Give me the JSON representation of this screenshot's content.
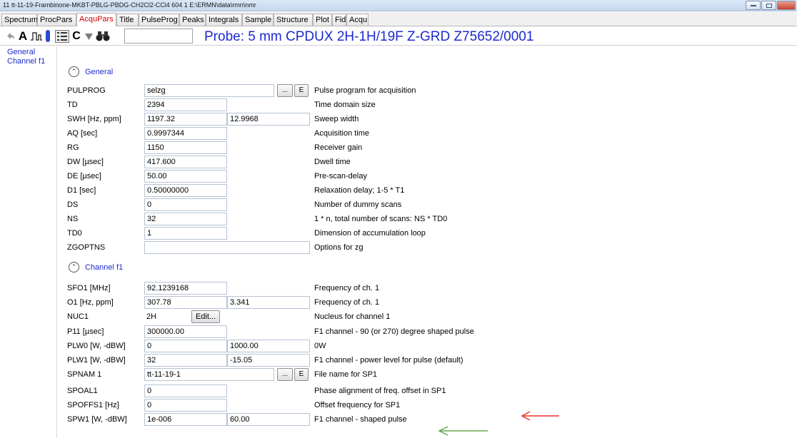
{
  "window": {
    "title": "11 tt-11-19-Frambinone-MKBT-PBLG-PBDG-CH2Cl2-CCl4 604 1 E:\\ERMN\\data\\rmn\\nmr"
  },
  "tabs": [
    {
      "label": "Spectrum"
    },
    {
      "label": "ProcPars"
    },
    {
      "label": "AcquPars"
    },
    {
      "label": "Title"
    },
    {
      "label": "PulseProg"
    },
    {
      "label": "Peaks"
    },
    {
      "label": "Integrals"
    },
    {
      "label": "Sample"
    },
    {
      "label": "Structure"
    },
    {
      "label": "Plot"
    },
    {
      "label": "Fid"
    },
    {
      "label": "Acqu"
    }
  ],
  "active_tab": "AcquPars",
  "toolbar": {
    "icons": [
      "undo-icon",
      "font-a-icon",
      "pulse-program-icon",
      "tube-icon",
      "table-view-icon",
      "c-icon",
      "filter-icon",
      "binoculars-icon"
    ],
    "search_value": "",
    "probe_text": "Probe: 5 mm CPDUX 2H-1H/19F Z-GRD Z75652/0001"
  },
  "nav": {
    "items": [
      {
        "label": "General"
      },
      {
        "label": "Channel f1"
      }
    ]
  },
  "general": {
    "heading": "General",
    "rows": [
      {
        "name": "PULPROG",
        "v1": "selzg",
        "desc": "Pulse program for acquisition",
        "browse": "...",
        "edit": "E"
      },
      {
        "name": "TD",
        "v1": "2394",
        "desc": "Time domain size"
      },
      {
        "name": "SWH [Hz, ppm]",
        "v1": "1197.32",
        "v2": "12.9968",
        "desc": "Sweep width"
      },
      {
        "name": "AQ [sec]",
        "v1": "0.9997344",
        "desc": "Acquisition time"
      },
      {
        "name": "RG",
        "v1": "1150",
        "desc": "Receiver gain"
      },
      {
        "name": "DW [µsec]",
        "v1": "417.600",
        "desc": "Dwell time"
      },
      {
        "name": "DE [µsec]",
        "v1": "50.00",
        "desc": "Pre-scan-delay"
      },
      {
        "name": "D1 [sec]",
        "v1": "0.50000000",
        "desc": "Relaxation delay; 1-5 * T1"
      },
      {
        "name": "DS",
        "v1": "0",
        "desc": "Number of dummy scans"
      },
      {
        "name": "NS",
        "v1": "32",
        "desc": "1 * n, total number of scans: NS * TD0"
      },
      {
        "name": "TD0",
        "v1": "1",
        "desc": "Dimension of accumulation loop"
      },
      {
        "name": "ZGOPTNS",
        "v1": "",
        "desc": "Options for zg"
      }
    ]
  },
  "channel_f1": {
    "heading": "Channel f1",
    "rows": [
      {
        "name": "SFO1 [MHz]",
        "v1": "92.1239168",
        "desc": "Frequency of ch. 1"
      },
      {
        "name": "O1 [Hz, ppm]",
        "v1": "307.78",
        "v2": "3.341",
        "desc": "Frequency of ch. 1"
      },
      {
        "name": "NUC1",
        "v1": "2H",
        "desc": "Nucleus for channel 1",
        "edit_label": "Edit..."
      },
      {
        "name": "P11 [µsec]",
        "v1": "300000.00",
        "desc": "F1 channel -  90 (or 270) degree shaped pulse"
      },
      {
        "name": "PLW0 [W, -dBW]",
        "v1": "0",
        "v2": "1000.00",
        "desc": "0W"
      },
      {
        "name": "PLW1 [W, -dBW]",
        "v1": "32",
        "v2": "-15.05",
        "desc": "F1 channel - power level for pulse (default)"
      },
      {
        "name": "SPNAM 1",
        "v1": "tt-11-19-1",
        "desc": "File name for SP1",
        "browse": "...",
        "edit": "E"
      },
      {
        "name": "SPOAL1",
        "v1": "0",
        "desc": "Phase alignment of freq. offset in SP1"
      },
      {
        "name": "SPOFFS1 [Hz]",
        "v1": "0",
        "desc": "Offset frequency for SP1"
      },
      {
        "name": "SPW1 [W, -dBW]",
        "v1": "1e-006",
        "v2": "60.00",
        "desc": "F1 channel - shaped pulse"
      }
    ]
  },
  "annotations": {
    "red_arrow_color": "#e8352e",
    "green_arrow_color": "#6aa84f"
  }
}
